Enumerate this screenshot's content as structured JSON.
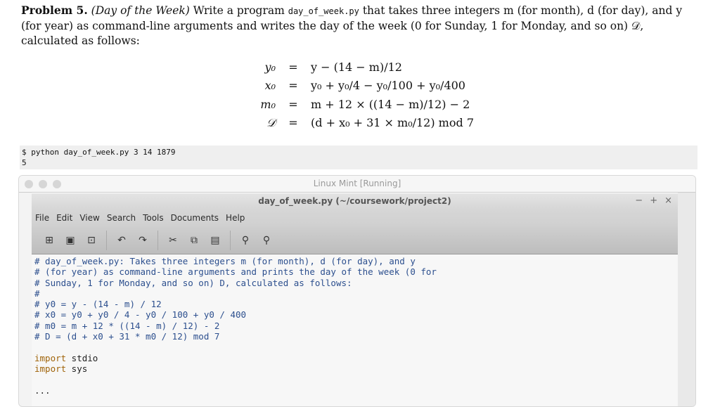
{
  "problem": {
    "label": "Problem 5.",
    "title": "(Day of the Week)",
    "text1": " Write a program ",
    "filename": "day_of_week.py",
    "text2": " that takes three integers m (for month), d (for day), and y (for year) as command-line arguments and writes the day of the week (0 for Sunday, 1 for Monday, and so on) 𝒟, calculated as follows:"
  },
  "math": [
    {
      "lhs": "y₀",
      "eq": "=",
      "rhs": "y − (14 − m)/12"
    },
    {
      "lhs": "x₀",
      "eq": "=",
      "rhs": "y₀ + y₀/4 − y₀/100 + y₀/400"
    },
    {
      "lhs": "m₀",
      "eq": "=",
      "rhs": "m + 12 × ((14 − m)/12) − 2"
    },
    {
      "lhs": "𝒟",
      "eq": "=",
      "rhs": "(d + x₀ + 31 × m₀/12) mod 7"
    }
  ],
  "terminal": {
    "command": "$ python day_of_week.py 3 14 1879",
    "output": "5"
  },
  "vm": {
    "title": "Linux Mint [Running]"
  },
  "gedit": {
    "title": "day_of_week.py (~/coursework/project2)",
    "window_controls": [
      "−",
      "+",
      "×"
    ],
    "menu": [
      "File",
      "Edit",
      "View",
      "Search",
      "Tools",
      "Documents",
      "Help"
    ],
    "comments": [
      "# day_of_week.py: Takes three integers m (for month), d (for day), and y",
      "# (for year) as command-line arguments and prints the day of the week (0 for",
      "# Sunday, 1 for Monday, and so on) D, calculated as follows:",
      "#",
      "# y0 = y - (14 - m) / 12",
      "# x0 = y0 + y0 / 4 - y0 / 100 + y0 / 400",
      "# m0 = m + 12 * ((14 - m) / 12) - 2",
      "# D = (d + x0 + 31 * m0 / 12) mod 7"
    ],
    "imports": [
      {
        "kw": "import",
        "mod": " stdio"
      },
      {
        "kw": "import",
        "mod": " sys"
      }
    ],
    "ellipsis": "..."
  }
}
